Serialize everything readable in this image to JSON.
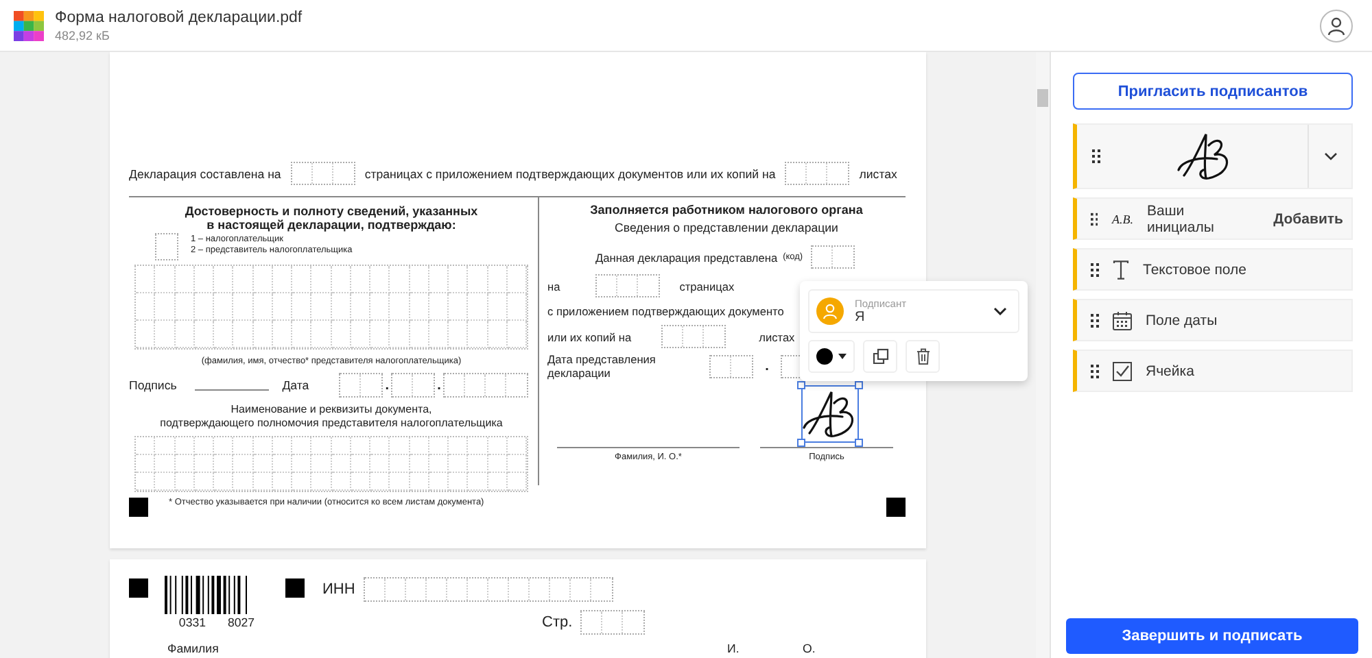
{
  "file": {
    "name": "Форма налоговой декларации.pdf",
    "size": "482,92 кБ"
  },
  "page1": {
    "intro": [
      "Декларация составлена на",
      "страницах с приложением подтверждающих документов или их копий на",
      "листах"
    ],
    "left": {
      "heading": [
        "Достоверность и полноту сведений, указанных",
        "в настоящей декларации, подтверждаю:"
      ],
      "roles": [
        "1 – налогоплательщик",
        "2 – представитель налогоплательщика"
      ],
      "name_caption": "(фамилия, имя, отчество* представителя налогоплательщика)",
      "signature_label": "Подпись",
      "date_label": "Дата",
      "date_separators": [
        ".",
        "."
      ],
      "document_caption": [
        "Наименование и реквизиты документа,",
        "подтверждающего полномочия представителя налогоплательщика"
      ]
    },
    "right": {
      "heading": "Заполняется работником налогового органа",
      "subheading": "Сведения о представлении декларации",
      "submitted_label": "Данная декларация представлена",
      "code_label": "(код)",
      "on_label": "на",
      "pages_label": "страницах",
      "attachments_label": "с приложением подтверждающих документо",
      "copies_label": "или их копий на",
      "sheets_label": "листах",
      "date_label": "Дата представления декларации",
      "date_separator": ".",
      "name_caption": "Фамилия, И. О.*",
      "signature_caption": "Подпись"
    },
    "footnote": "* Отчество указывается при наличии (относится ко всем листам документа)"
  },
  "page2": {
    "barcode_digits": [
      "0331",
      "8027"
    ],
    "inn_label": "ИНН",
    "page_label": "Стр.",
    "surname_label": "Фамилия",
    "initial_labels": [
      "И.",
      "О."
    ]
  },
  "signer_popup": {
    "role_label": "Подписант",
    "signer": "Я"
  },
  "panel": {
    "invite_button": "Пригласить подписантов",
    "fields": [
      {
        "kind": "signature"
      },
      {
        "kind": "initials",
        "sample": "A.B.",
        "label": "Ваши инициалы",
        "action": "Добавить"
      },
      {
        "kind": "text",
        "label": "Текстовое поле"
      },
      {
        "kind": "date",
        "label": "Поле даты"
      },
      {
        "kind": "checkbox",
        "label": "Ячейка"
      }
    ],
    "finish_button": "Завершить и подписать"
  }
}
